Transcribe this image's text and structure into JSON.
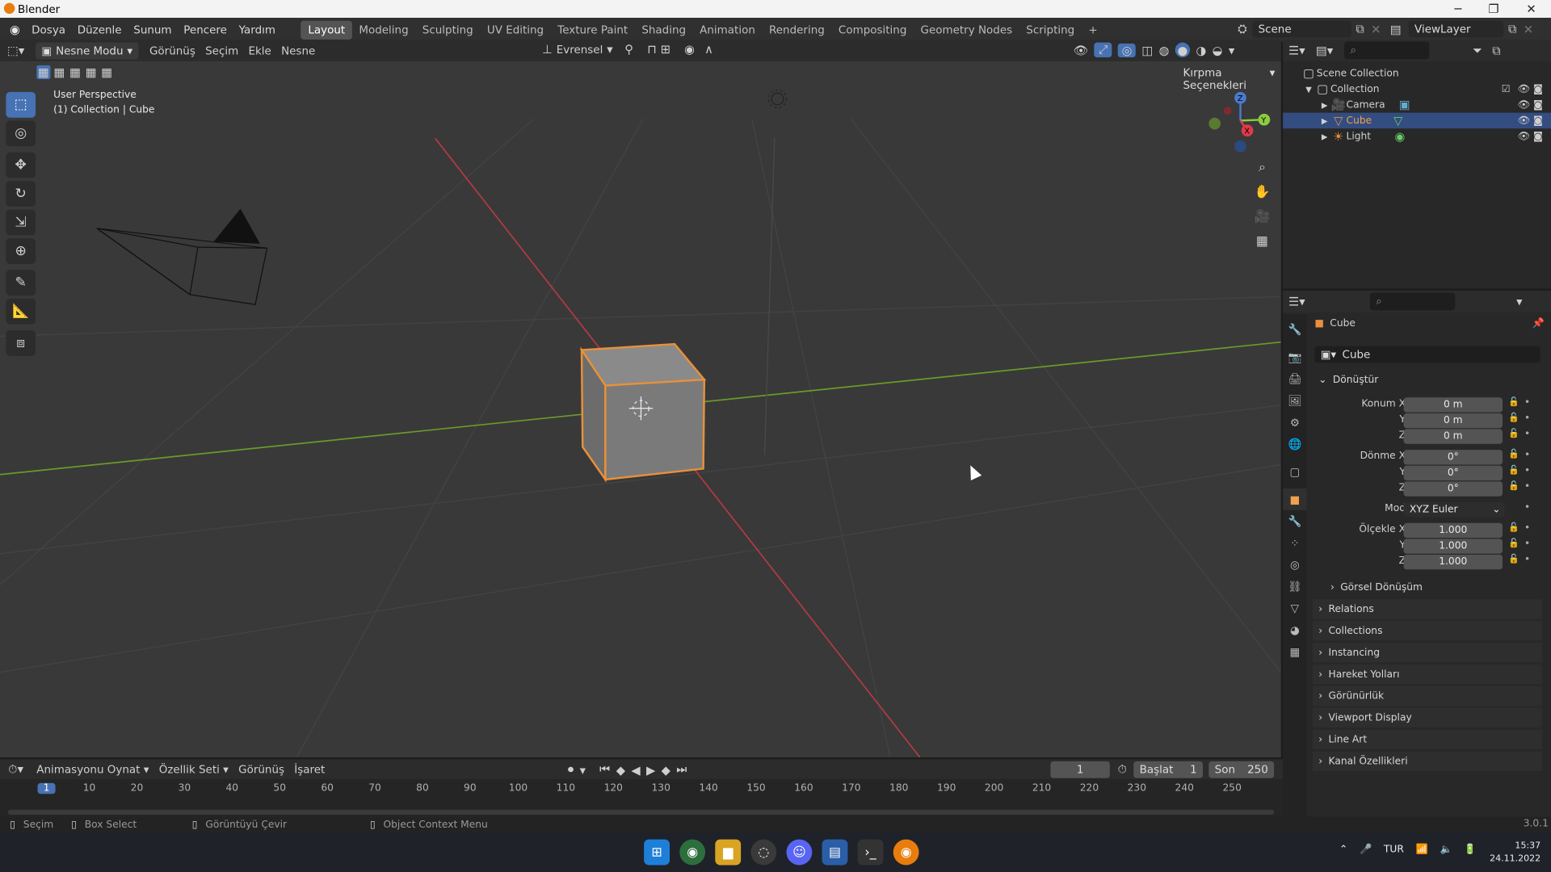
{
  "window": {
    "title": "Blender"
  },
  "menu": {
    "items": [
      "Dosya",
      "Düzenle",
      "Sunum",
      "Pencere",
      "Yardım"
    ],
    "workspaces": [
      "Layout",
      "Modeling",
      "Sculpting",
      "UV Editing",
      "Texture Paint",
      "Shading",
      "Animation",
      "Rendering",
      "Compositing",
      "Geometry Nodes",
      "Scripting"
    ],
    "add_workspace": "+",
    "scene": "Scene",
    "view_layer": "ViewLayer"
  },
  "viewport_header": {
    "mode": "Nesne Modu",
    "view": "Görünüş",
    "select": "Seçim",
    "add": "Ekle",
    "object": "Nesne",
    "orientation": "Evrensel",
    "options": "Kırpma Seçenekleri"
  },
  "viewport": {
    "perspective": "User Perspective",
    "context": "(1) Collection | Cube",
    "accent": "#e8903a"
  },
  "outliner": {
    "root": "Scene Collection",
    "collection": "Collection",
    "items": [
      {
        "name": "Camera",
        "selected": false
      },
      {
        "name": "Cube",
        "selected": true
      },
      {
        "name": "Light",
        "selected": false
      }
    ]
  },
  "properties": {
    "object_name": "Cube",
    "data_name": "Cube",
    "transform_title": "Dönüştür",
    "location_label": "Konum X",
    "rotation_label": "Dönme X",
    "scale_label": "Ölçekle X",
    "y_label": "Y",
    "z_label": "Z",
    "mode_label": "Mod",
    "location": [
      "0 m",
      "0 m",
      "0 m"
    ],
    "rotation": [
      "0°",
      "0°",
      "0°"
    ],
    "mode": "XYZ Euler",
    "scale": [
      "1.000",
      "1.000",
      "1.000"
    ],
    "delta": "Görsel Dönüşüm",
    "sections": [
      "Relations",
      "Collections",
      "Instancing",
      "Hareket Yolları",
      "Görünürlük",
      "Viewport Display",
      "Line Art",
      "Kanal Özellikleri"
    ]
  },
  "timeline": {
    "playback": "Animasyonu Oynat",
    "keying": "Özellik Seti",
    "view": "Görünüş",
    "marker": "İşaret",
    "current_frame": "1",
    "start_label": "Başlat",
    "start": "1",
    "end_label": "Son",
    "end": "250",
    "ticks": [
      "1",
      "10",
      "20",
      "30",
      "40",
      "50",
      "60",
      "70",
      "80",
      "90",
      "100",
      "110",
      "120",
      "130",
      "140",
      "150",
      "160",
      "170",
      "180",
      "190",
      "200",
      "210",
      "220",
      "230",
      "240",
      "250"
    ]
  },
  "status": {
    "select": "Seçim",
    "box": "Box Select",
    "rotate": "Görüntüyü Çevir",
    "context": "Object Context Menu",
    "version": "3.0.1"
  },
  "taskbar": {
    "lang": "TUR",
    "time": "15:37",
    "date": "24.11.2022"
  }
}
